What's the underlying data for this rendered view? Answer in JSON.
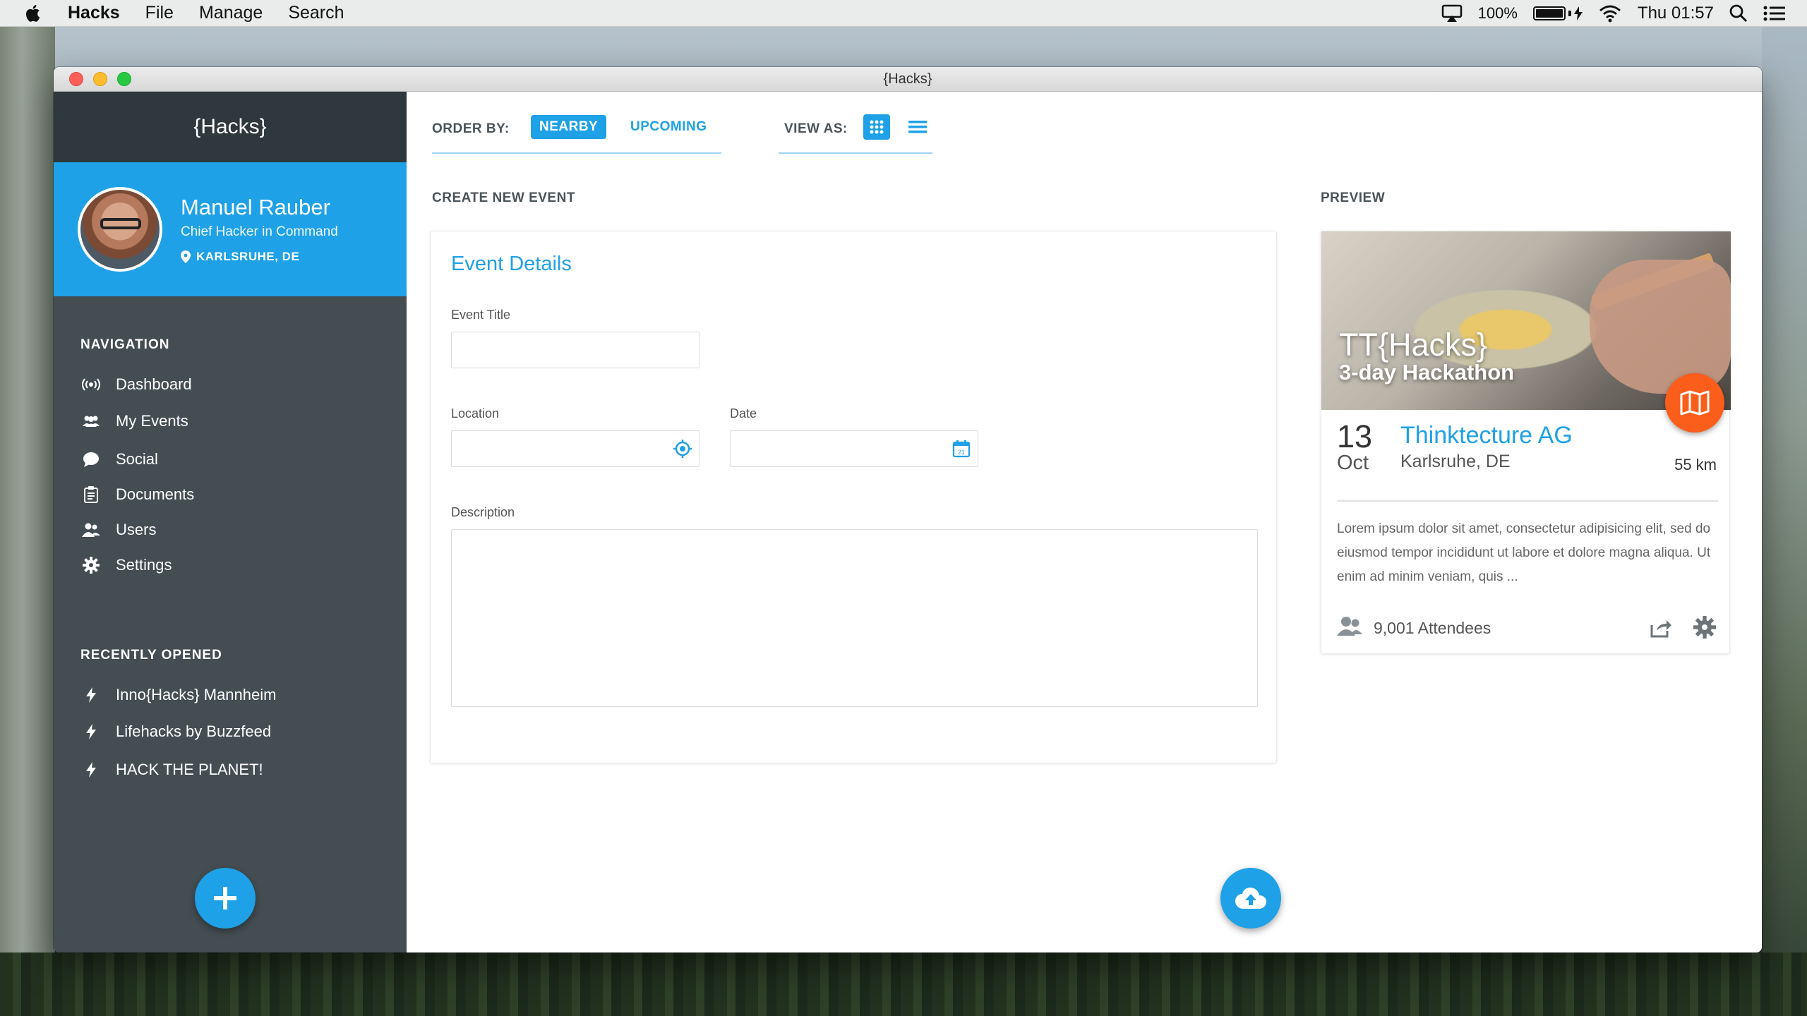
{
  "menubar": {
    "app_name": "Hacks",
    "menus": [
      "File",
      "Manage",
      "Search"
    ],
    "battery": "100%",
    "clock": "Thu 01:57"
  },
  "window": {
    "title": "{Hacks}"
  },
  "sidebar": {
    "brand": "{Hacks}",
    "profile": {
      "name": "Manuel Rauber",
      "role": "Chief Hacker in Command",
      "location": "KARLSRUHE, DE"
    },
    "navigation_heading": "NAVIGATION",
    "nav": [
      {
        "label": "Dashboard",
        "icon": "broadcast-icon"
      },
      {
        "label": "My Events",
        "icon": "group-icon"
      },
      {
        "label": "Social",
        "icon": "chat-icon"
      },
      {
        "label": "Documents",
        "icon": "clipboard-icon"
      },
      {
        "label": "Users",
        "icon": "users-icon"
      },
      {
        "label": "Settings",
        "icon": "gear-icon"
      }
    ],
    "recent_heading": "RECENTLY  OPENED",
    "recent": [
      {
        "label": "Inno{Hacks} Mannheim",
        "icon": "bolt-icon"
      },
      {
        "label": "Lifehacks by Buzzfeed",
        "icon": "bolt-icon"
      },
      {
        "label": "HACK THE PLANET!",
        "icon": "bolt-icon"
      }
    ]
  },
  "toolbar": {
    "order_by_label": "ORDER BY:",
    "order_options": [
      "NEARBY",
      "UPCOMING"
    ],
    "order_selected": "NEARBY",
    "view_as_label": "VIEW AS:",
    "view_options": [
      "grid-icon",
      "list-icon"
    ],
    "view_selected": "grid-icon"
  },
  "form": {
    "section_title": "CREATE NEW EVENT",
    "heading": "Event Details",
    "event_title_label": "Event Title",
    "event_title_value": "",
    "location_label": "Location",
    "location_value": "",
    "date_label": "Date",
    "date_value": "",
    "date_icon_text": "21",
    "description_label": "Description",
    "description_value": ""
  },
  "preview": {
    "section_title": "PREVIEW",
    "title": "TT{Hacks}",
    "subtitle": "3-day Hackathon",
    "day": "13",
    "month": "Oct",
    "organizer": "Thinktecture AG",
    "city": "Karlsruhe, DE",
    "distance": "55 km",
    "description": "Lorem ipsum dolor sit amet, consectetur adipisicing elit, sed do eiusmod tempor incididunt ut labore et dolore magna aliqua. Ut enim ad minim veniam, quis ...",
    "attendees": "9,001 Attendees"
  },
  "colors": {
    "accent": "#1ea1e6",
    "sidebar": "#434d52",
    "sidebar_header": "#2f383c",
    "map_fab": "#fb5d1b"
  }
}
